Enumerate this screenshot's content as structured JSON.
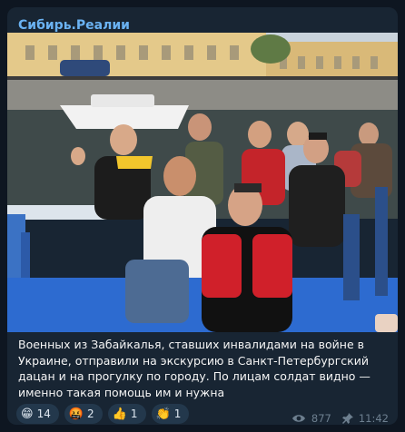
{
  "channel": {
    "name": "Сибирь.Реалии"
  },
  "post": {
    "caption": "Военных из Забайкалья, ставших инвалидами на войне в Украине, отправили на экскурсию в Санкт-Петербургский дацан и на прогулку по городу. По лицам солдат видно — именно такая помощь им и нужна"
  },
  "reactions": [
    {
      "emoji": "😁",
      "count": "14"
    },
    {
      "emoji": "🤬",
      "count": "2"
    },
    {
      "emoji": "👍",
      "count": "1"
    },
    {
      "emoji": "👏",
      "count": "1"
    }
  ],
  "meta": {
    "views": "877",
    "time": "11:42",
    "views_icon": "eye-icon",
    "pin_icon": "pin-icon"
  },
  "colors": {
    "background": "#0e1621",
    "bubble": "#182533",
    "channel_name": "#6ab2f2",
    "reaction_bg": "#23384c",
    "meta_text": "#6d7f8f"
  }
}
